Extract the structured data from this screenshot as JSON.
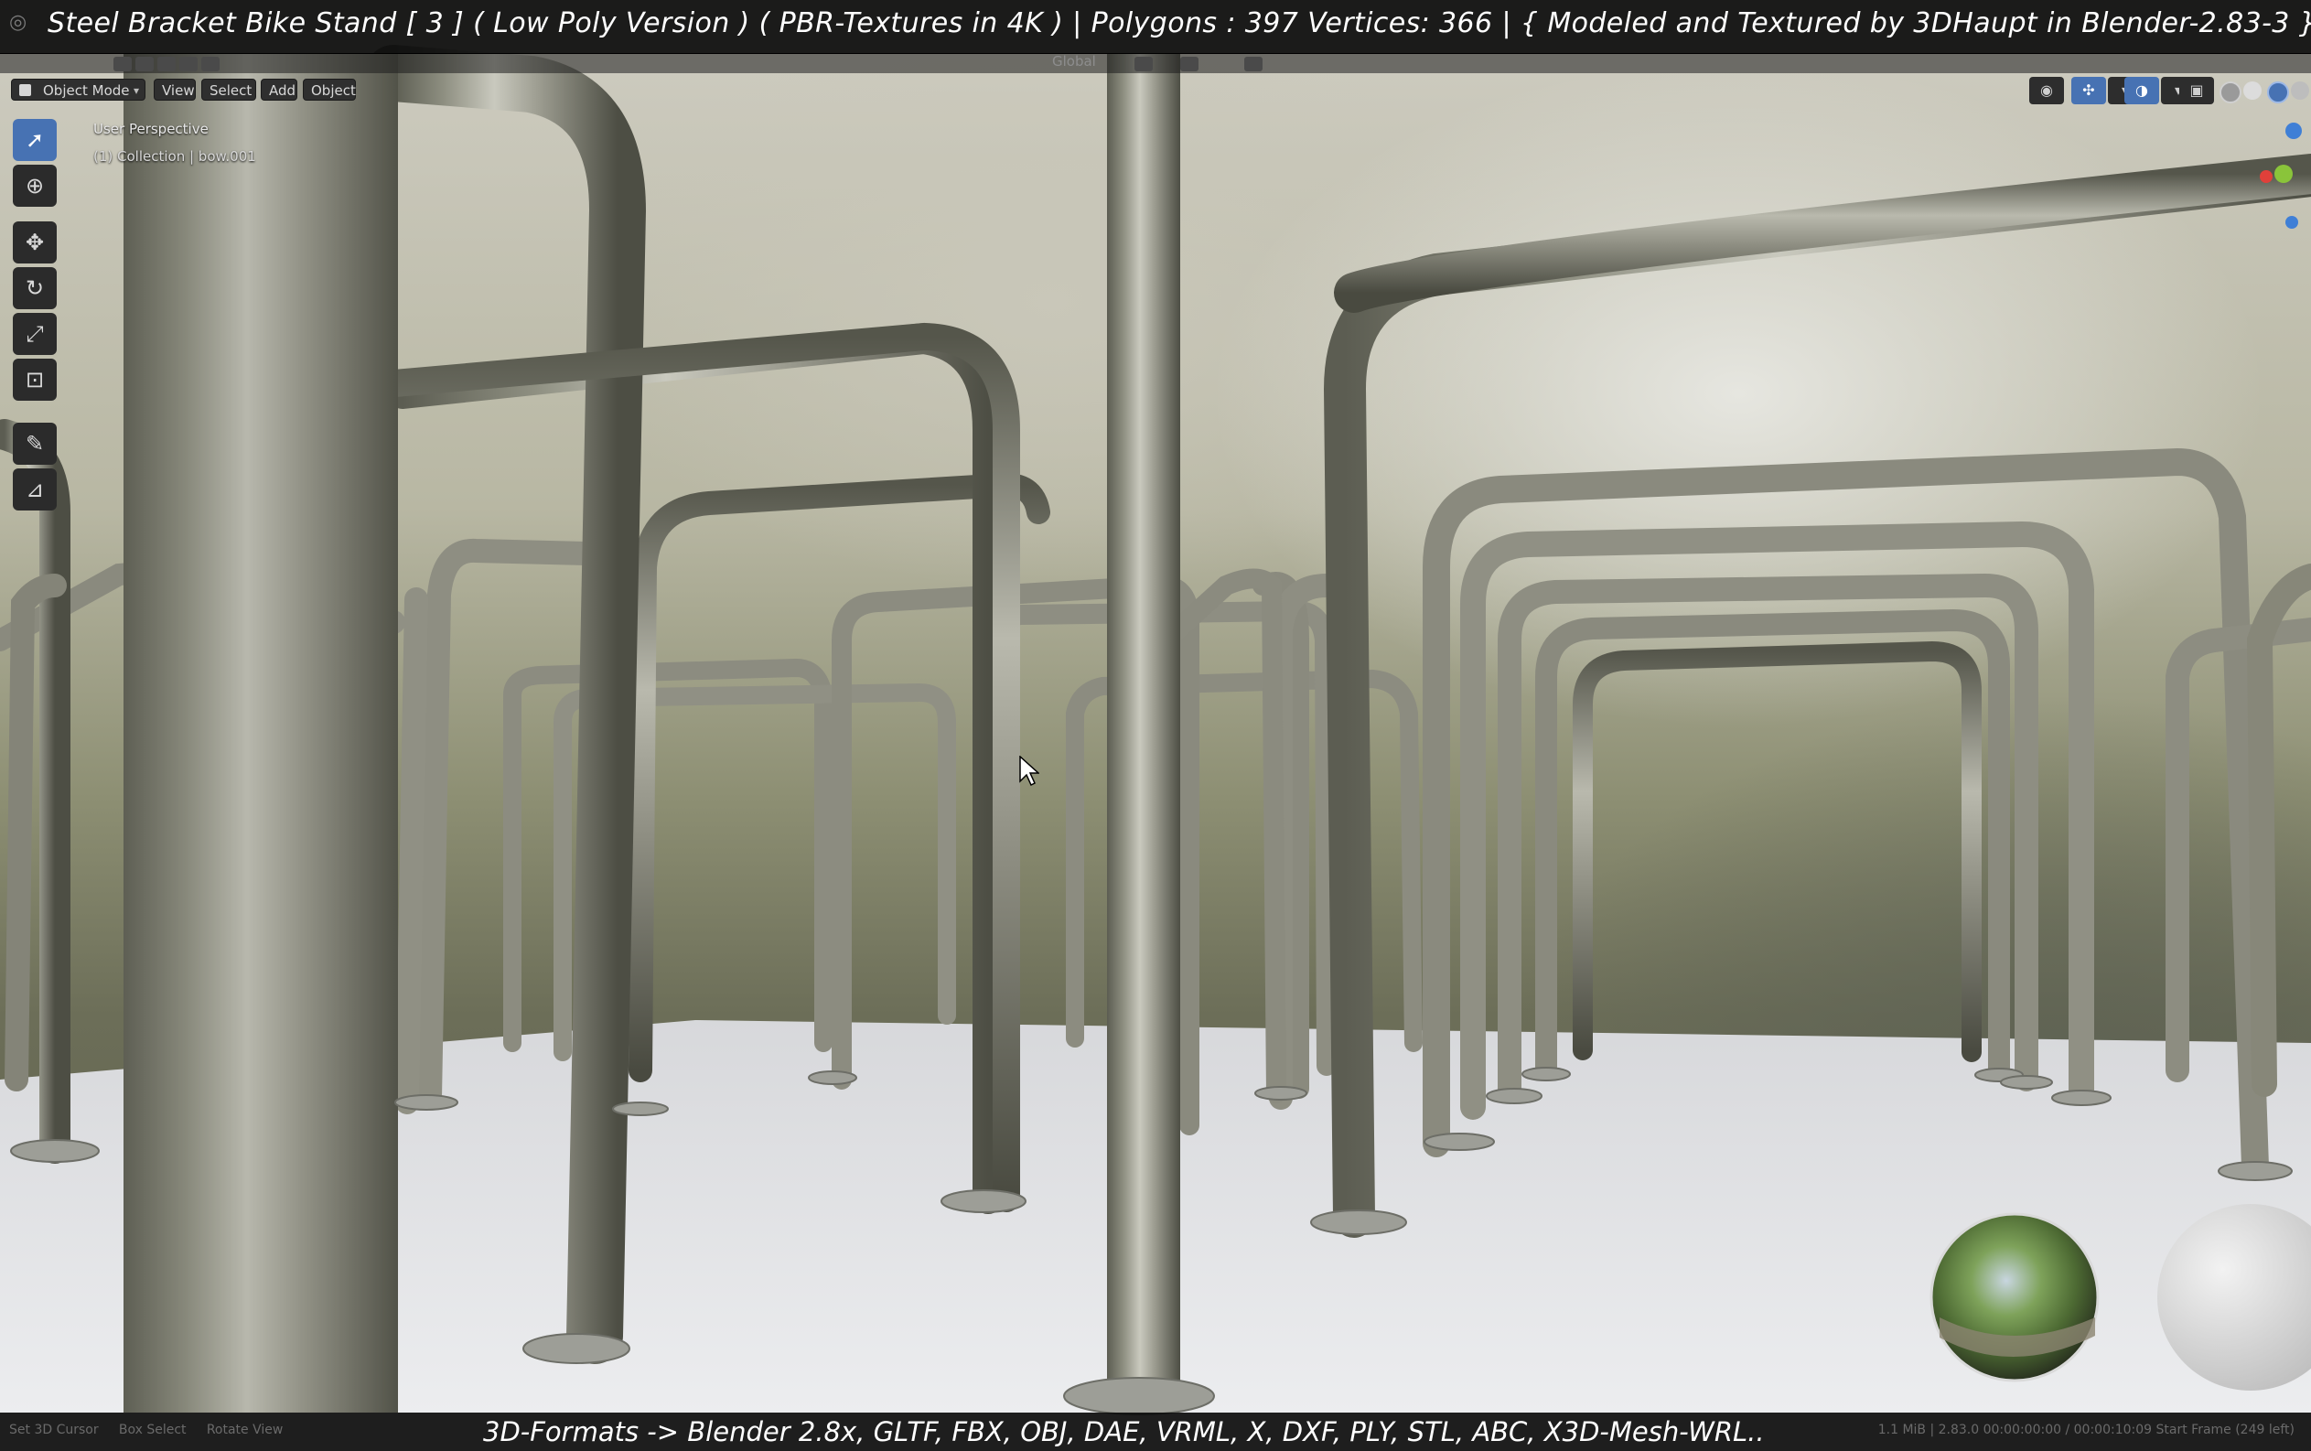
{
  "title_overlay": {
    "text": "Steel Bracket Bike Stand [ 3 ] ( Low Poly Version ) ( PBR-Textures in 4K )  |   Polygons : 397  Vertices: 366    |    { Modeled and Textured by 3DHaupt in Blender-2.83-3 }"
  },
  "header": {
    "orientation": "Global"
  },
  "mode_bar": {
    "mode": "Object Mode",
    "menus": [
      "View",
      "Select",
      "Add",
      "Object"
    ]
  },
  "viewport_info": {
    "perspective": "User Perspective",
    "collection": "(1) Collection | bow.001"
  },
  "tools": [
    {
      "name": "select-box-icon",
      "glyph": "➚"
    },
    {
      "name": "cursor-icon",
      "glyph": "⊕"
    },
    {
      "name": "move-icon",
      "glyph": "✥"
    },
    {
      "name": "rotate-icon",
      "glyph": "↻"
    },
    {
      "name": "scale-icon",
      "glyph": "⤢"
    },
    {
      "name": "transform-icon",
      "glyph": "⊡"
    },
    {
      "name": "annotate-icon",
      "glyph": "✎"
    },
    {
      "name": "measure-icon",
      "glyph": "📐"
    }
  ],
  "gizmo": {
    "axes": [
      "X",
      "Y",
      "Z"
    ],
    "colors": {
      "x": "#e0403a",
      "y": "#8ac43a",
      "z": "#3f7fd6"
    }
  },
  "caption": {
    "text": "3D-Formats -> Blender 2.8x, GLTF, FBX, OBJ, DAE, VRML, X, DXF, PLY, STL, ABC, X3D-Mesh-WRL.."
  },
  "status_bar": {
    "hints": [
      "Set 3D Cursor",
      "Box Select",
      "Rotate View"
    ],
    "right": "1.1 MiB | 2.83.0    00:00:00:00 / 00:00:10:09    Start Frame (249 left)"
  },
  "colors": {
    "accent": "#4772b3",
    "panel": "#2b2b2b",
    "steel": "#8f8f84",
    "floor": "#e6e7ea"
  }
}
